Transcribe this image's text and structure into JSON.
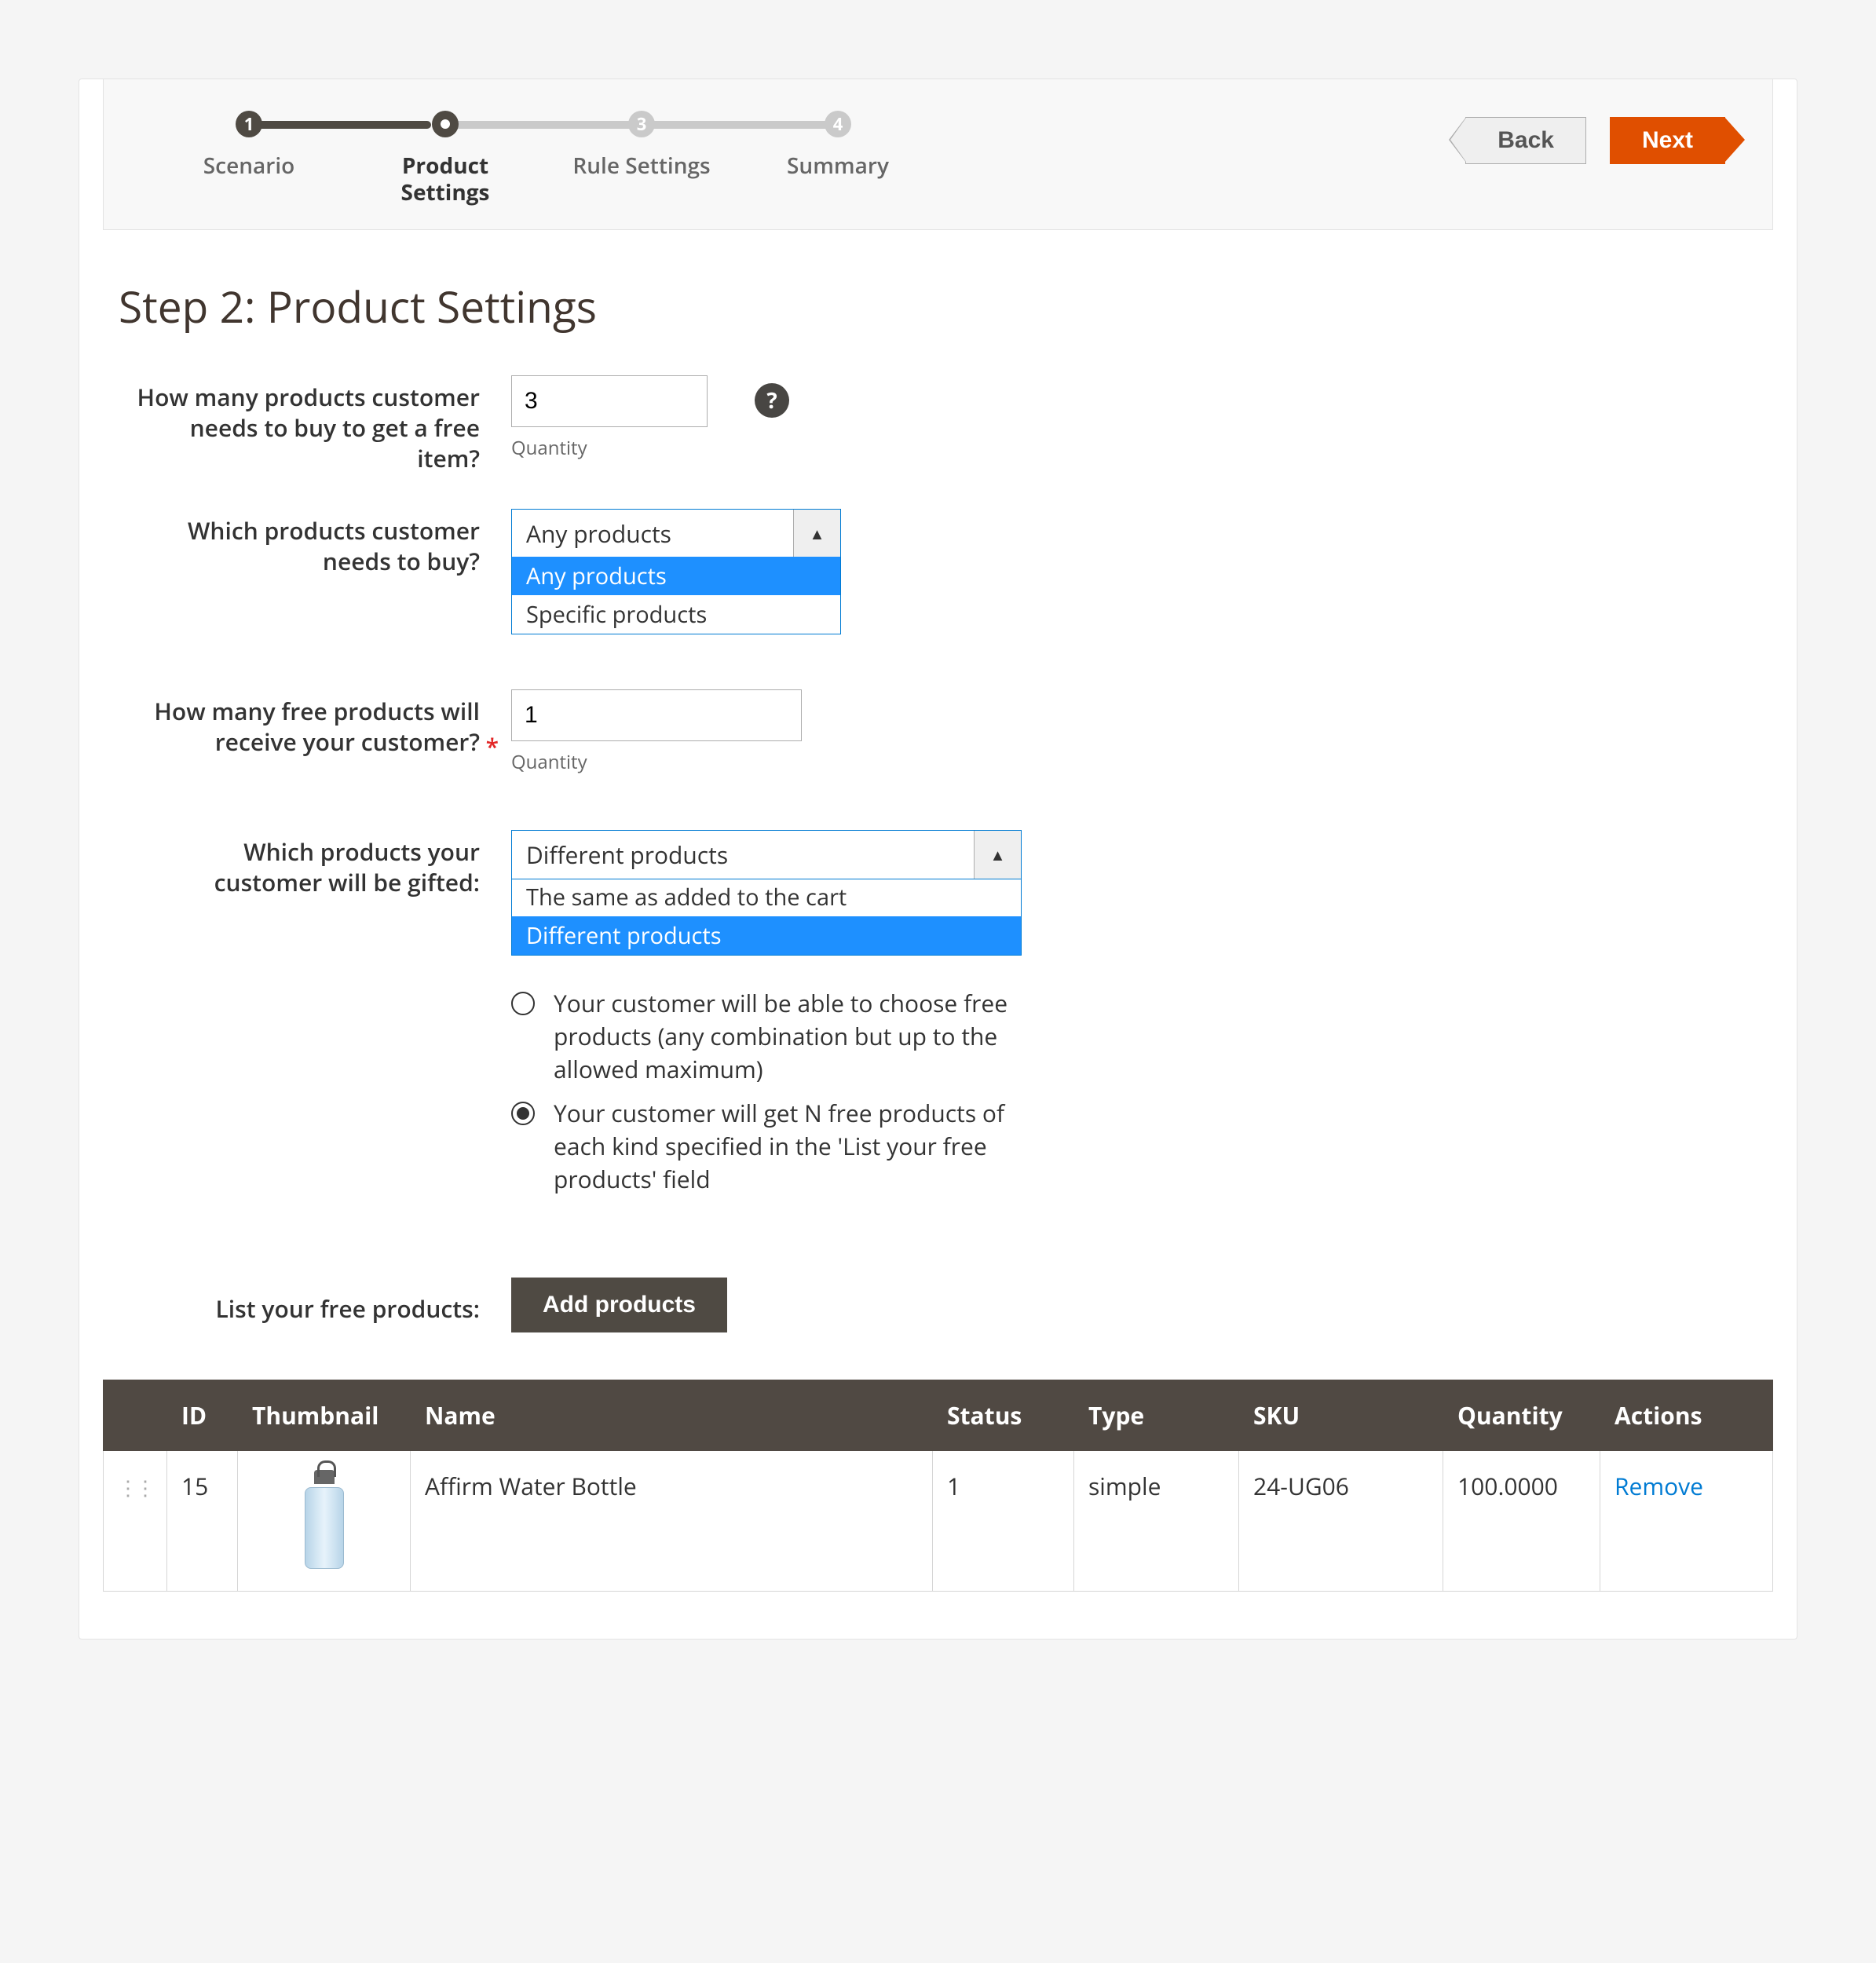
{
  "wizard": {
    "steps": [
      {
        "num": "1",
        "label": "Scenario"
      },
      {
        "num": "•",
        "label": "Product\nSettings"
      },
      {
        "num": "3",
        "label": "Rule Settings"
      },
      {
        "num": "4",
        "label": "Summary"
      }
    ],
    "back": "Back",
    "next": "Next"
  },
  "title": "Step 2: Product Settings",
  "q1": {
    "label": "How many products customer needs to buy to get a free item?",
    "value": "3",
    "hint": "Quantity"
  },
  "q2": {
    "label": "Which products customer needs to buy?",
    "selected": "Any products",
    "options": [
      "Any products",
      "Specific products"
    ],
    "selectedIdx": 0
  },
  "q3": {
    "label": "How many free products will receive your customer?",
    "required": true,
    "value": "1",
    "hint": "Quantity"
  },
  "q4": {
    "label": "Which products your customer will be gifted:",
    "selected": "Different products",
    "options": [
      "The same as added to the cart",
      "Different products"
    ],
    "selectedIdx": 1
  },
  "radios": {
    "a": "Your customer will be able to choose free products (any combination but up to the allowed maximum)",
    "b": "Your customer will get N free products of each kind specified in the 'List your free products' field",
    "checked": "b"
  },
  "list_label": "List your free products:",
  "add_btn": "Add products",
  "table": {
    "cols": [
      "",
      "ID",
      "Thumbnail",
      "Name",
      "Status",
      "Type",
      "SKU",
      "Quantity",
      "Actions"
    ],
    "rows": [
      {
        "id": "15",
        "name": "Affirm Water Bottle",
        "status": "1",
        "type": "simple",
        "sku": "24-UG06",
        "qty": "100.0000",
        "action": "Remove"
      }
    ]
  }
}
